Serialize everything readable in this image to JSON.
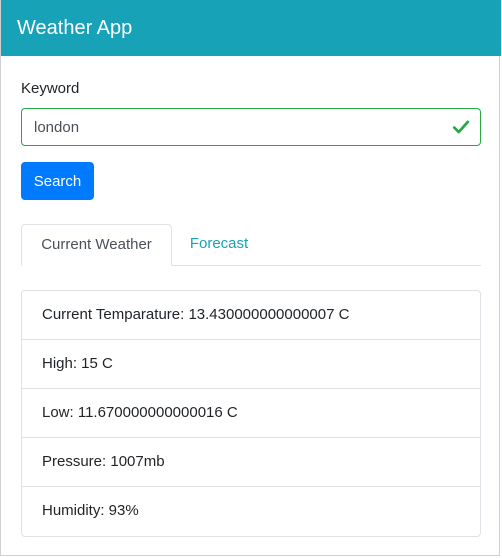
{
  "navbar": {
    "title": "Weather App"
  },
  "search": {
    "label": "Keyword",
    "value": "london",
    "button_label": "Search"
  },
  "tabs": [
    {
      "label": "Current Weather",
      "active": true
    },
    {
      "label": "Forecast",
      "active": false
    }
  ],
  "weather": {
    "items": [
      {
        "text": "Current Temparature: 13.430000000000007 C"
      },
      {
        "text": "High: 15 C"
      },
      {
        "text": "Low: 11.670000000000016 C"
      },
      {
        "text": "Pressure: 1007mb"
      },
      {
        "text": "Humidity: 93%"
      }
    ]
  },
  "colors": {
    "navbar": "#17a2b8",
    "primary": "#007bff",
    "valid": "#28a745",
    "tab_link": "#17a2b8"
  },
  "icons": {
    "valid": "check-icon"
  }
}
